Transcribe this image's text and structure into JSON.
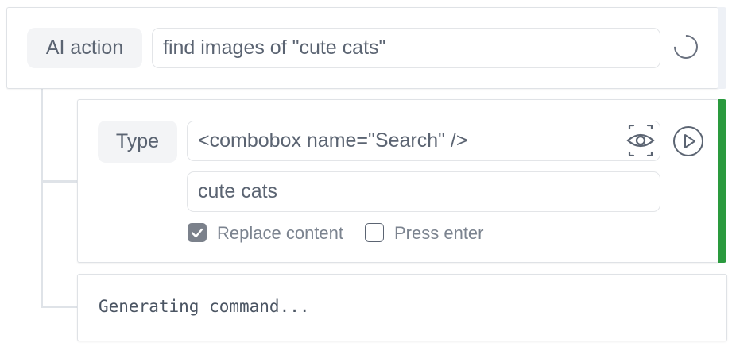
{
  "ai_action": {
    "tag_label": "AI action",
    "prompt_value": "find images of \"cute cats\"",
    "status": "loading"
  },
  "type_step": {
    "tag_label": "Type",
    "target_value": "<combobox name=\"Search\" />",
    "text_value": "cute cats",
    "replace_content": {
      "label": "Replace content",
      "checked": true
    },
    "press_enter": {
      "label": "Press enter",
      "checked": false
    },
    "accent_color": "#2a9a3e"
  },
  "generating": {
    "text": "Generating command..."
  },
  "icons": {
    "spinner": "loading-spinner-icon",
    "preview": "eye-icon",
    "run": "play-icon",
    "check": "checkmark-icon"
  }
}
